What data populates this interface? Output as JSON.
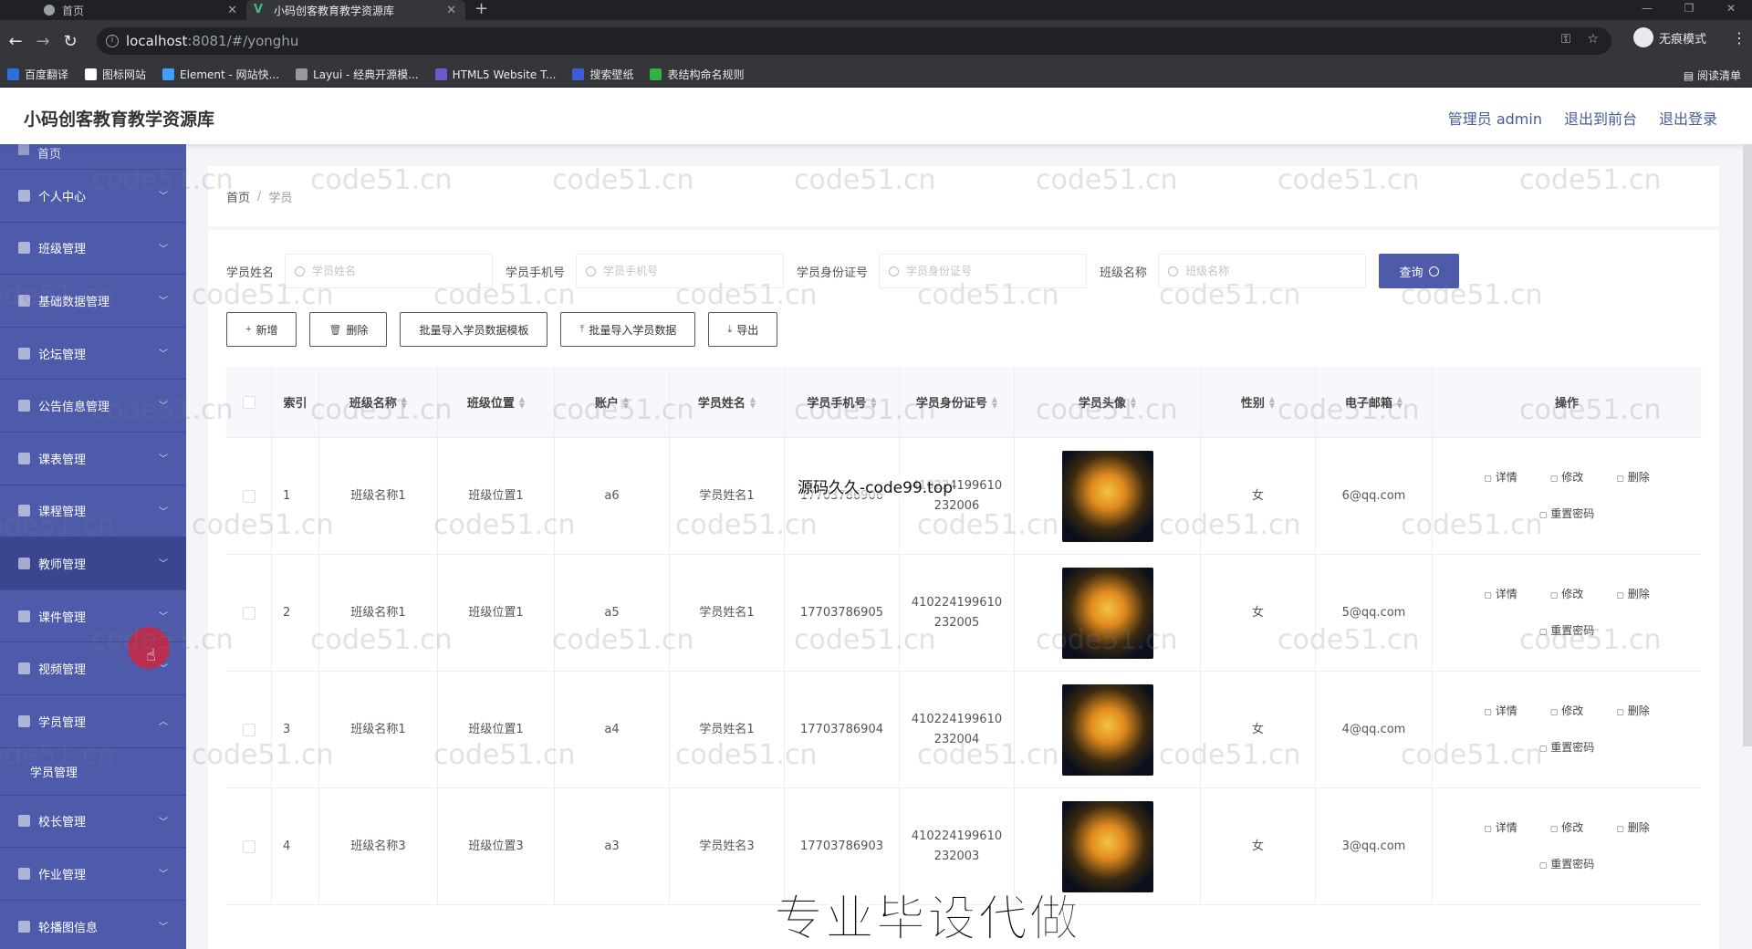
{
  "browser": {
    "tabs": [
      {
        "title": "首页",
        "active": false
      },
      {
        "title": "小码创客教育教学资源库",
        "active": true
      }
    ],
    "url_host": "localhost",
    "url_path": ":8081/#/yonghu",
    "incognito_label": "无痕模式",
    "bookmarks": [
      {
        "label": "百度翻译",
        "color": "#2a6fdb"
      },
      {
        "label": "图标网站",
        "color": "#ffffff"
      },
      {
        "label": "Element - 网站快...",
        "color": "#409eff"
      },
      {
        "label": "Layui - 经典开源模...",
        "color": "#999999"
      },
      {
        "label": "HTML5 Website T...",
        "color": "#6a5acd"
      },
      {
        "label": "搜索壁纸",
        "color": "#3b5bdb"
      },
      {
        "label": "表结构命名规则",
        "color": "#2fb344"
      }
    ],
    "reading_list": "阅读清单"
  },
  "header": {
    "title": "小码创客教育教学资源库",
    "links": [
      "管理员 admin",
      "退出到前台",
      "退出登录"
    ]
  },
  "sidebar": {
    "top_partial": "首页",
    "items": [
      {
        "label": "个人中心",
        "open": false
      },
      {
        "label": "班级管理",
        "open": false
      },
      {
        "label": "基础数据管理",
        "open": false
      },
      {
        "label": "论坛管理",
        "open": false
      },
      {
        "label": "公告信息管理",
        "open": false
      },
      {
        "label": "课表管理",
        "open": false
      },
      {
        "label": "课程管理",
        "open": false
      },
      {
        "label": "教师管理",
        "open": false
      },
      {
        "label": "课件管理",
        "open": false
      },
      {
        "label": "视频管理",
        "open": false
      },
      {
        "label": "学员管理",
        "open": true
      },
      {
        "label": "校长管理",
        "open": false
      },
      {
        "label": "作业管理",
        "open": false
      },
      {
        "label": "轮播图信息",
        "open": false
      }
    ],
    "sub_item": "学员管理",
    "accent": "#4e5bab"
  },
  "breadcrumb": {
    "home": "首页",
    "current": "学员"
  },
  "search": {
    "fields": [
      {
        "label": "学员姓名",
        "placeholder": "学员姓名"
      },
      {
        "label": "学员手机号",
        "placeholder": "学员手机号"
      },
      {
        "label": "学员身份证号",
        "placeholder": "学员身份证号"
      },
      {
        "label": "班级名称",
        "placeholder": "班级名称"
      }
    ],
    "query_button": "查询"
  },
  "actions": [
    {
      "label": "新增",
      "icon": "plus-icon",
      "glyph": "+"
    },
    {
      "label": "删除",
      "icon": "trash-icon",
      "glyph": "🗑"
    },
    {
      "label": "批量导入学员数据模板",
      "icon": "",
      "glyph": ""
    },
    {
      "label": "批量导入学员数据",
      "icon": "upload-icon",
      "glyph": "⤒"
    },
    {
      "label": "导出",
      "icon": "download-icon",
      "glyph": "⤓"
    }
  ],
  "table": {
    "columns": [
      "索引",
      "班级名称",
      "班级位置",
      "账户",
      "学员姓名",
      "学员手机号",
      "学员身份证号",
      "学员头像",
      "性别",
      "电子邮箱",
      "操作"
    ],
    "rows": [
      {
        "index": "1",
        "class_name": "班级名称1",
        "class_pos": "班级位置1",
        "account": "a6",
        "name": "学员姓名1",
        "phone": "17703786906",
        "id1": "410224199610",
        "id2": "232006",
        "sex": "女",
        "email": "6@qq.com"
      },
      {
        "index": "2",
        "class_name": "班级名称1",
        "class_pos": "班级位置1",
        "account": "a5",
        "name": "学员姓名1",
        "phone": "17703786905",
        "id1": "410224199610",
        "id2": "232005",
        "sex": "女",
        "email": "5@qq.com"
      },
      {
        "index": "3",
        "class_name": "班级名称1",
        "class_pos": "班级位置1",
        "account": "a4",
        "name": "学员姓名1",
        "phone": "17703786904",
        "id1": "410224199610",
        "id2": "232004",
        "sex": "女",
        "email": "4@qq.com"
      },
      {
        "index": "4",
        "class_name": "班级名称3",
        "class_pos": "班级位置3",
        "account": "a3",
        "name": "学员姓名3",
        "phone": "17703786903",
        "id1": "410224199610",
        "id2": "232003",
        "sex": "女",
        "email": "3@qq.com"
      }
    ],
    "op_labels": {
      "detail": "详情",
      "edit": "修改",
      "delete": "删除",
      "reset": "重置密码"
    }
  },
  "overlay": {
    "line1": "源码久久-code99.top",
    "line2": "专业毕设代做",
    "watermark": "code51.cn"
  }
}
